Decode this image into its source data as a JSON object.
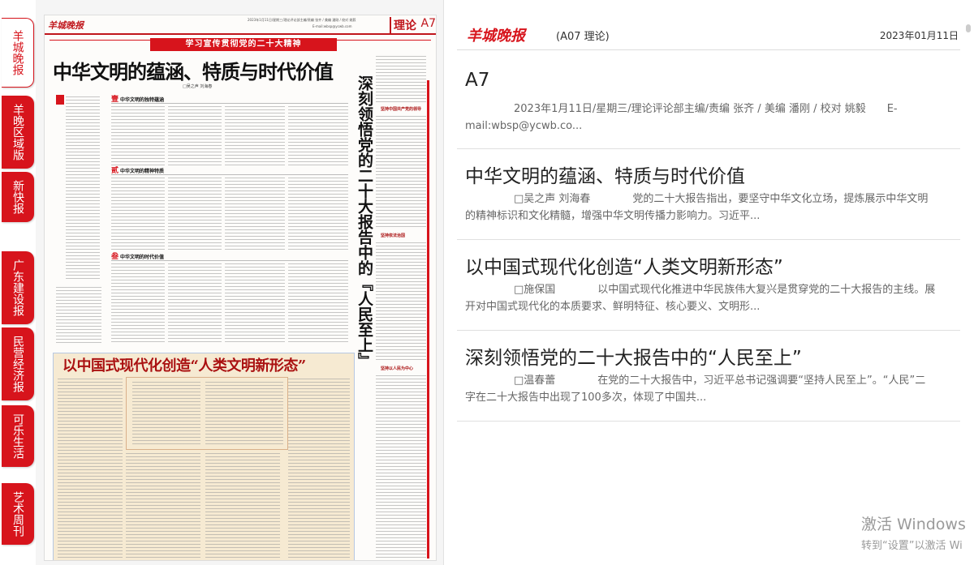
{
  "tabs": [
    {
      "label": "羊城晚报",
      "active": true
    },
    {
      "label": "羊晚区域版"
    },
    {
      "label": "新快报"
    },
    {
      "label": "广东建设报"
    },
    {
      "label": "民营经济报"
    },
    {
      "label": "可乐生活"
    },
    {
      "label": "艺术周刊"
    }
  ],
  "paper": {
    "logo": "羊城晚报",
    "meta": "2023年1月11日/星期三/理论评论部主编/责编 张齐 / 美编 潘刚 / 校对 姚毅",
    "meta_email": "E-mail:wbsp@ycwb.com",
    "section": "理论",
    "page": "A7",
    "banner": "学习宣传贯彻党的二十大精神",
    "headline1": "中华文明的蕴涵、特质与时代价值",
    "byline1": "□吴之声 刘海春",
    "sub1": "中华文明的独特蕴涵",
    "sub1_num": "壹",
    "sub2": "中华文明的精神特质",
    "sub2_num": "贰",
    "sub3": "中华文明的时代价值",
    "sub3_num": "叁",
    "vertical_headline": "深刻领悟党的二十大报告中的『人民至上』",
    "headline2": "以中国式现代化创造“人类文明新形态”",
    "right_sub1": "坚持中国共产党的领导",
    "right_sub2": "坚持依法治国",
    "right_sub3": "坚持以人民为中心"
  },
  "panel": {
    "logo": "羊城晚报",
    "edition": "(A07 理论)",
    "date": "2023年01月11日",
    "articles": [
      {
        "title": "A7",
        "summary": "2023年1月11日/星期三/理论评论部主编/责编 张齐 / 美编 潘刚 / 校对 姚毅　　E-mail:wbsp@ycwb.co..."
      },
      {
        "title": "中华文明的蕴涵、特质与时代价值",
        "summary": "□吴之声 刘海春　　　　党的二十大报告指出，要坚守中华文化立场，提炼展示中华文明的精神标识和文化精髓，增强中华文明传播力影响力。习近平..."
      },
      {
        "title": "以中国式现代化创造“人类文明新形态”",
        "summary": "□施保国　　　　以中国式现代化推进中华民族伟大复兴是贯穿党的二十大报告的主线。展开对中国式现代化的本质要求、鲜明特征、核心要义、文明形..."
      },
      {
        "title": "深刻领悟党的二十大报告中的“人民至上”",
        "summary": "□温春蕾　　　　在党的二十大报告中，习近平总书记强调要“坚持人民至上”。“人民”二字在二十大报告中出现了100多次，体现了中国共..."
      }
    ]
  },
  "watermark": {
    "line1": "激活 Windows",
    "line2": "转到“设置”以激活 Wi"
  },
  "colors": {
    "brand_red": "#d7141c"
  }
}
